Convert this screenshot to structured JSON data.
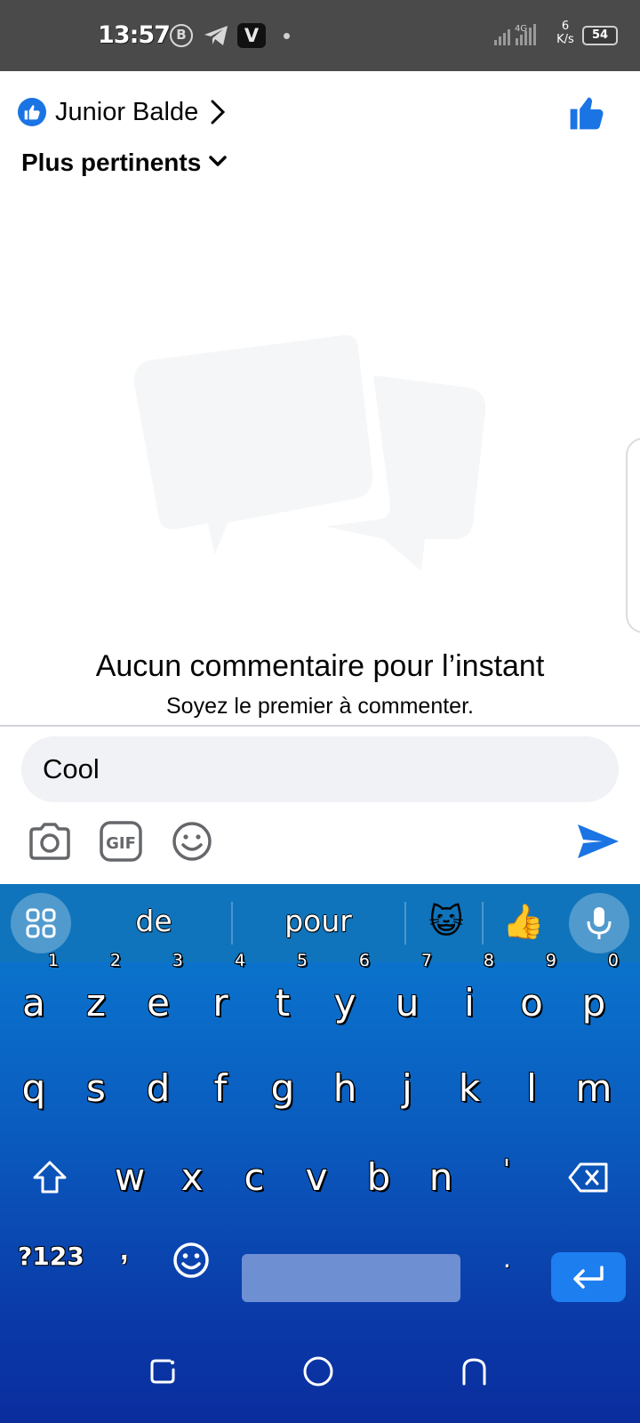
{
  "status_bar": {
    "time": "13:57",
    "b_badge": "B",
    "v_badge": "V",
    "net_speed_value": "6",
    "net_speed_unit": "K/s",
    "battery": "54"
  },
  "header": {
    "profile_name": "Junior Balde",
    "sort_label": "Plus pertinents"
  },
  "empty_state": {
    "title": "Aucun commentaire pour l’instant",
    "subtitle": "Soyez le premier à commenter."
  },
  "composer": {
    "input_value": "Cool",
    "gif_label": "GIF"
  },
  "keyboard": {
    "suggestions": [
      "de",
      "pour"
    ],
    "emoji_suggestions": [
      "😺",
      "👍"
    ],
    "row1": [
      {
        "k": "a",
        "n": "1"
      },
      {
        "k": "z",
        "n": "2"
      },
      {
        "k": "e",
        "n": "3"
      },
      {
        "k": "r",
        "n": "4"
      },
      {
        "k": "t",
        "n": "5"
      },
      {
        "k": "y",
        "n": "6"
      },
      {
        "k": "u",
        "n": "7"
      },
      {
        "k": "i",
        "n": "8"
      },
      {
        "k": "o",
        "n": "9"
      },
      {
        "k": "p",
        "n": "0"
      }
    ],
    "row2": [
      "q",
      "s",
      "d",
      "f",
      "g",
      "h",
      "j",
      "k",
      "l",
      "m"
    ],
    "row3": [
      "w",
      "x",
      "c",
      "v",
      "b",
      "n",
      "'"
    ],
    "symbols_key": "?123",
    "comma_key": ",",
    "period_key": "."
  },
  "colors": {
    "facebook_blue": "#1b74e4",
    "keyboard_top": "#0b7dd2",
    "keyboard_bottom": "#0b2d9e"
  }
}
